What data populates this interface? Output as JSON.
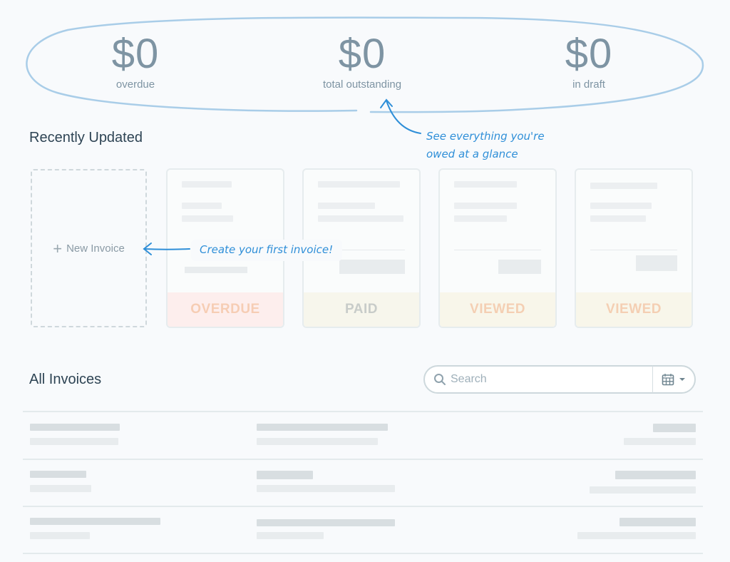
{
  "summary": {
    "stats": [
      {
        "amount": "$0",
        "label": "overdue"
      },
      {
        "amount": "$0",
        "label": "total outstanding"
      },
      {
        "amount": "$0",
        "label": "in draft"
      }
    ],
    "annotation": {
      "line1": "See everything you're",
      "line2": "owed at a glance"
    },
    "accent_color": "#2f8fd8"
  },
  "recent": {
    "title": "Recently Updated",
    "new_invoice_label": "New Invoice",
    "annotation": "Create your first invoice!",
    "cards": [
      {
        "status": "OVERDUE"
      },
      {
        "status": "PAID"
      },
      {
        "status": "VIEWED"
      },
      {
        "status": "VIEWED"
      }
    ]
  },
  "invoices": {
    "title": "All Invoices",
    "search_placeholder": "Search",
    "search_value": "",
    "filter_icon": "calendar-icon",
    "rows": 3
  }
}
